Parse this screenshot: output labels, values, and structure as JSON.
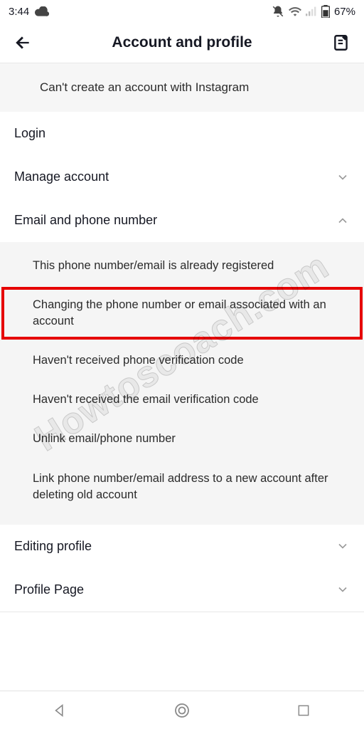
{
  "status": {
    "time": "3:44",
    "battery_pct": "67%"
  },
  "header": {
    "title": "Account and profile"
  },
  "banner": {
    "text": "Can't create an account with Instagram"
  },
  "rows": {
    "login": "Login",
    "manage": "Manage account",
    "email_phone": "Email and phone number",
    "editing": "Editing profile",
    "profile_page": "Profile Page"
  },
  "email_phone_sub": [
    "This phone number/email is already registered",
    "Changing the phone number or email associated with an account",
    "Haven't received phone verification code",
    "Haven't received the email verification code",
    "Unlink email/phone number",
    "Link phone number/email address to a new account after deleting old account"
  ],
  "watermark": "Howtoscoach.com"
}
